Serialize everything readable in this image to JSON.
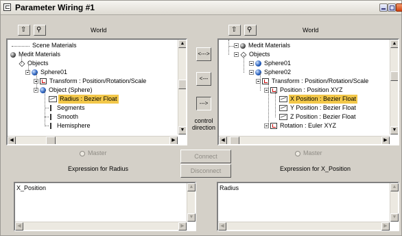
{
  "window": {
    "title": "Parameter Wiring #1"
  },
  "left_panel": {
    "world_label": "World",
    "tree": [
      {
        "label": "Scene Materials",
        "icon": "none",
        "indent": 0
      },
      {
        "label": "Medit Materials",
        "icon": "material-icon",
        "indent": 0
      },
      {
        "label": "Objects",
        "icon": "objects-icon",
        "indent": 1
      },
      {
        "label": "Sphere01",
        "icon": "sphere-icon",
        "indent": 2
      },
      {
        "label": "Transform : Position/Rotation/Scale",
        "icon": "transform-icon",
        "indent": 3
      },
      {
        "label": "Object (Sphere)",
        "icon": "sphere-icon",
        "indent": 3
      },
      {
        "label": "Radius : Bezier Float",
        "icon": "controller-icon",
        "indent": 4,
        "selected": true
      },
      {
        "label": "Segments",
        "icon": "parameter-icon",
        "indent": 4
      },
      {
        "label": "Smooth",
        "icon": "parameter-icon",
        "indent": 4
      },
      {
        "label": "Hemisphere",
        "icon": "parameter-icon",
        "indent": 4
      }
    ],
    "master_label": "Master",
    "expression_label": "Expression for Radius",
    "expression_text": "X_Position"
  },
  "right_panel": {
    "world_label": "World",
    "tree": [
      {
        "label": "Medit Materials",
        "icon": "material-icon",
        "indent": 0
      },
      {
        "label": "Objects",
        "icon": "objects-icon",
        "indent": 1
      },
      {
        "label": "Sphere01",
        "icon": "sphere-icon",
        "indent": 2
      },
      {
        "label": "Sphere02",
        "icon": "sphere-icon",
        "indent": 2
      },
      {
        "label": "Transform : Position/Rotation/Scale",
        "icon": "transform-icon",
        "indent": 3
      },
      {
        "label": "Position : Position XYZ",
        "icon": "position-icon",
        "indent": 4
      },
      {
        "label": "X Position : Bezier Float",
        "icon": "controller-icon",
        "indent": 5,
        "selected": true
      },
      {
        "label": "Y Position : Bezier Float",
        "icon": "controller-icon",
        "indent": 5
      },
      {
        "label": "Z Position : Bezier Float",
        "icon": "controller-icon",
        "indent": 5
      },
      {
        "label": "Rotation : Euler XYZ",
        "icon": "rotation-icon",
        "indent": 4
      }
    ],
    "master_label": "Master",
    "expression_label": "Expression for X_Position",
    "expression_text": "Radius"
  },
  "center": {
    "both_ways_label": "<--->",
    "left_label": "<---",
    "right_label": "--->",
    "control_direction_label": "control\ndirection",
    "connect_label": "Connect",
    "disconnect_label": "Disconnect"
  },
  "colors": {
    "selection": "#f3c84a",
    "panel_bg": "#d4d0c8"
  }
}
